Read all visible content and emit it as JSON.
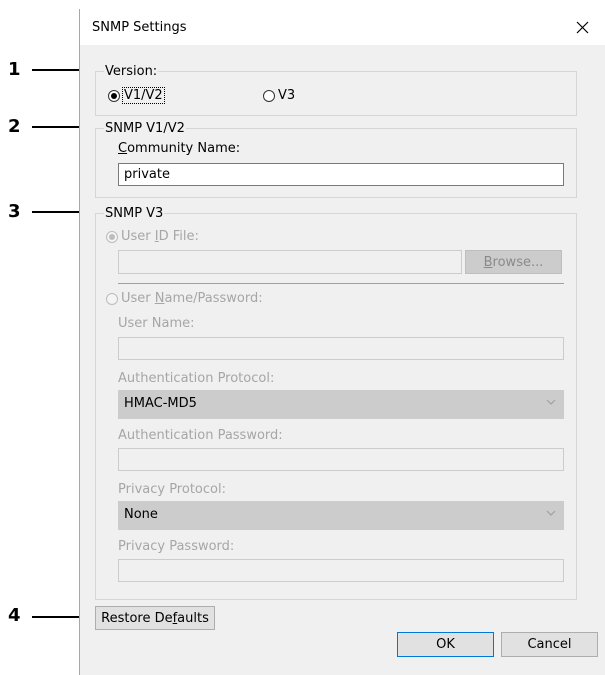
{
  "callouts": [
    "1",
    "2",
    "3",
    "4"
  ],
  "dialog": {
    "title": "SNMP Settings",
    "close_glyph": "✕"
  },
  "version": {
    "legend": "Version:",
    "v1v2_label": "V1/V2",
    "v3_label": "V3",
    "selected": "V1/V2"
  },
  "snmp_v1v2": {
    "legend": "SNMP V1/V2",
    "community_label_accel": "C",
    "community_label_rest": "ommunity Name:",
    "community_value": "private"
  },
  "snmp_v3": {
    "legend": "SNMP V3",
    "userid_radio_pre": "User ",
    "userid_radio_accel": "I",
    "userid_radio_post": "D File:",
    "userid_value": "",
    "browse_accel": "B",
    "browse_rest": "rowse...",
    "username_radio_pre": "User ",
    "username_radio_accel": "N",
    "username_radio_post": "ame/Password:",
    "user_name_label": "User Name:",
    "user_name_value": "",
    "auth_protocol_label": "Authentication Protocol:",
    "auth_protocol_value": "HMAC-MD5",
    "auth_password_label": "Authentication Password:",
    "auth_password_value": "",
    "privacy_protocol_label": "Privacy Protocol:",
    "privacy_protocol_value": "None",
    "privacy_password_label": "Privacy Password:",
    "privacy_password_value": ""
  },
  "footer": {
    "restore_pre": "Restore De",
    "restore_accel": "f",
    "restore_post": "aults",
    "ok_label": "OK",
    "cancel_label": "Cancel"
  },
  "icons": {
    "select_chevron": "chevron-down-icon",
    "close": "close-icon"
  },
  "colors": {
    "dialog_bg": "#f0f0f0",
    "disabled_text": "#a6a6a6",
    "select_bg": "#cccccc",
    "default_button_border": "#0078d7"
  }
}
